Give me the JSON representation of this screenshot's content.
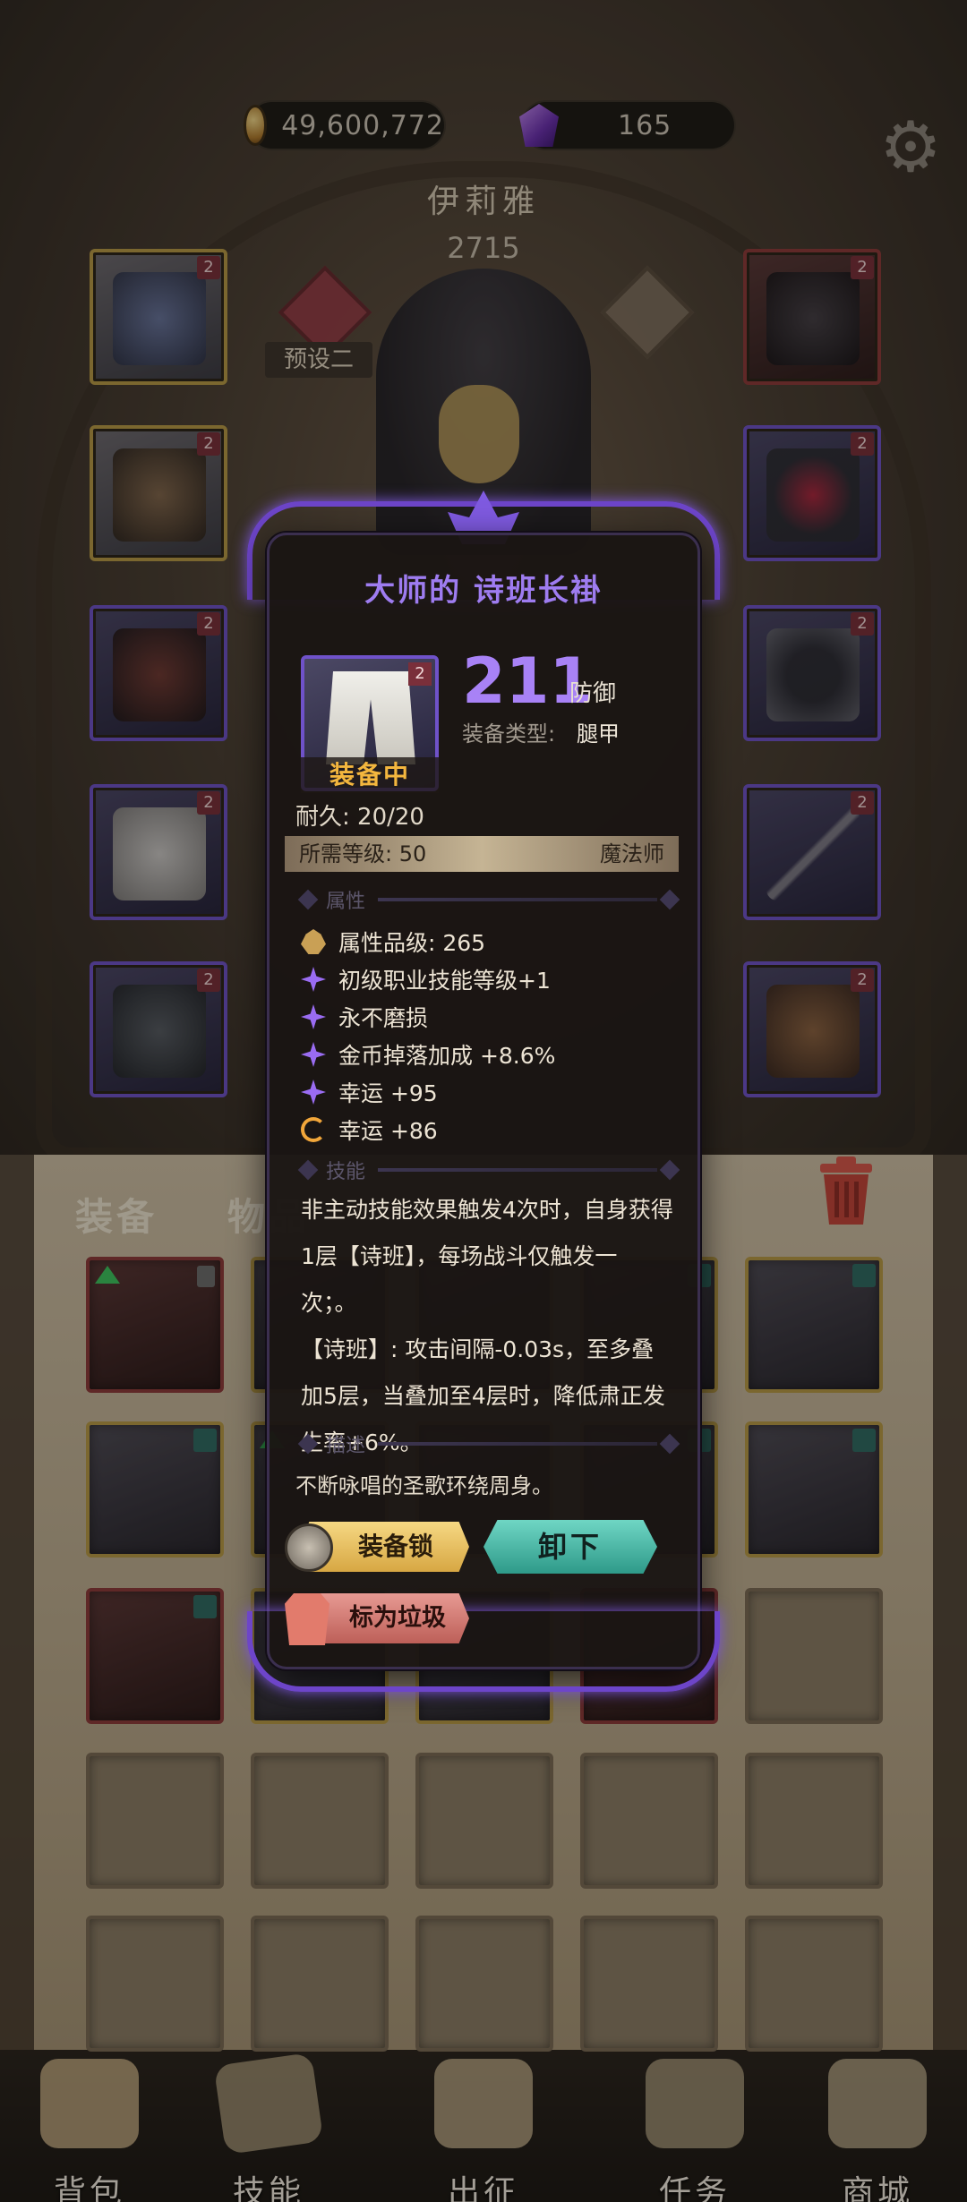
{
  "top_bar": {
    "gold": "49,600,772",
    "gems": "165",
    "gold_icon": "gold-coin-icon",
    "gem_icon": "purple-gem-icon",
    "settings_icon": "gear-icon"
  },
  "character": {
    "name": "伊莉雅",
    "power": "2715",
    "preset_label": "预设二"
  },
  "equipment_slots": [
    {
      "id": "left-1",
      "tier": "2"
    },
    {
      "id": "left-2",
      "tier": "2"
    },
    {
      "id": "left-3",
      "tier": "2"
    },
    {
      "id": "left-4",
      "tier": "2"
    },
    {
      "id": "left-5",
      "tier": "2"
    },
    {
      "id": "right-1",
      "tier": "2"
    },
    {
      "id": "right-2",
      "tier": "2"
    },
    {
      "id": "right-3",
      "tier": "2"
    },
    {
      "id": "right-4",
      "tier": "2"
    },
    {
      "id": "right-5",
      "tier": "2"
    }
  ],
  "tabs": {
    "equipment": "装备",
    "items": "物品"
  },
  "popup": {
    "title": "大师的 诗班长褂",
    "item_tier": "2",
    "equipped_tag": "装备中",
    "main_stat_value": "211",
    "main_stat_unit": "防御",
    "type_label": "装备类型:",
    "type_value": "腿甲",
    "durability": "耐久: 20/20",
    "required_level": "所需等级: 50",
    "required_class": "魔法师",
    "section_attributes": "属性",
    "attributes": [
      {
        "icon": "crest-icon",
        "text": "属性品级: 265"
      },
      {
        "icon": "star-icon",
        "text": "初级职业技能等级+1"
      },
      {
        "icon": "star-icon",
        "text": "永不磨损"
      },
      {
        "icon": "star-icon",
        "text": "金币掉落加成 +8.6%"
      },
      {
        "icon": "star-icon",
        "text": "幸运 +95"
      },
      {
        "icon": "cycle-icon",
        "text": "幸运 +86"
      }
    ],
    "section_skill": "技能",
    "skill_lines": [
      "非主动技能效果触发4次时，自身获得",
      "1层【诗班】，每场战斗仅触发一",
      "次；。",
      "【诗班】: 攻击间隔-0.03s，至多叠",
      "加5层，当叠加至4层时，降低肃正发",
      "生率+6%。"
    ],
    "section_description": "描述",
    "description": "不断咏唱的圣歌环绕周身。",
    "btn_lock": "装备锁",
    "btn_unequip": "卸下",
    "btn_trash": "标为垃圾"
  },
  "bottom_nav": [
    {
      "label": "背包",
      "icon": "backpack-icon"
    },
    {
      "label": "技能",
      "icon": "skill-book-icon"
    },
    {
      "label": "出征",
      "icon": "sword-map-icon"
    },
    {
      "label": "任务",
      "icon": "quest-scroll-icon"
    },
    {
      "label": "商城",
      "icon": "shop-crown-icon"
    }
  ],
  "colors": {
    "epic_purple": "#6f52c9",
    "title_purple": "#9e7cf0",
    "equipped_orange": "#f3b63e",
    "unequip_teal": "#3fb8a5",
    "trash_red": "#cf6b63",
    "lock_gold": "#e6bf5c"
  }
}
